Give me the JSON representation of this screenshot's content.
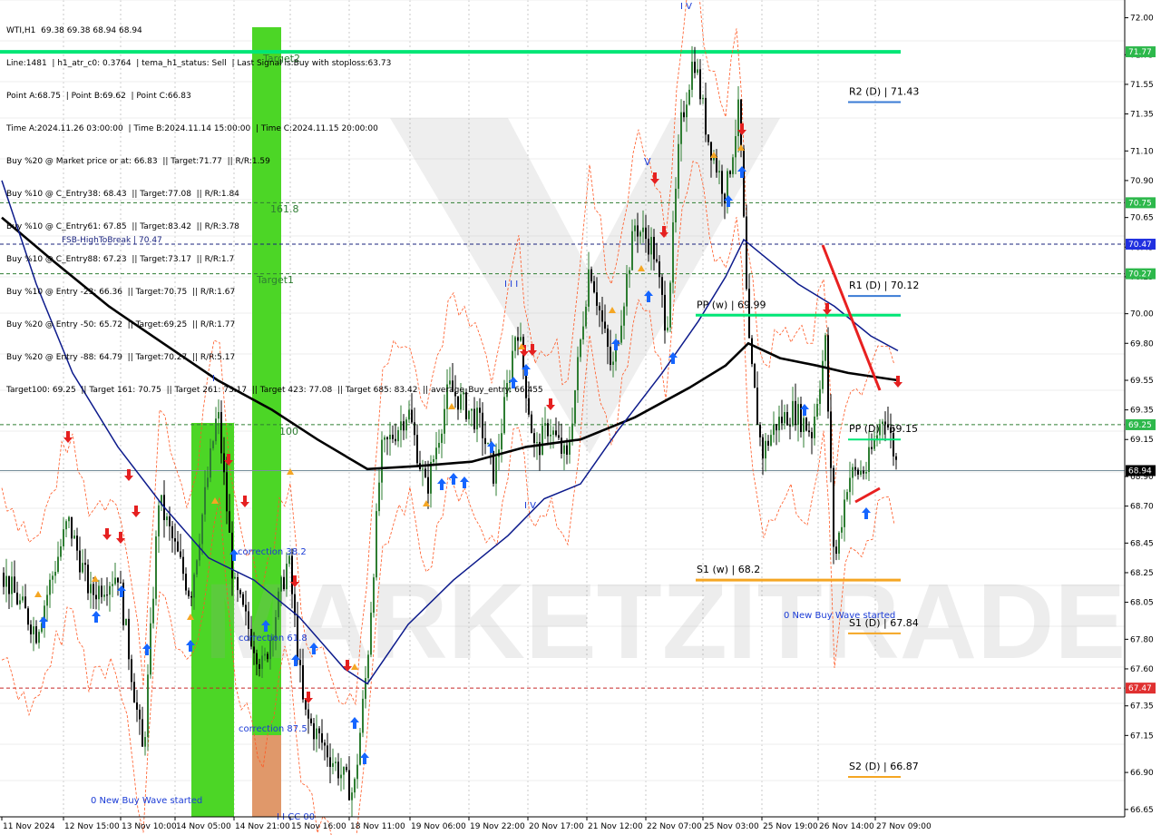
{
  "info_lines": [
    "WTI,H1  69.38 69.38 68.94 68.94",
    "Line:1481  | h1_atr_c0: 0.3764  | tema_h1_status: Sell  | Last Signal is:Buy with stoploss:63.73",
    "Point A:68.75  | Point B:69.62  | Point C:66.83",
    "Time A:2024.11.26 03:00:00  | Time B:2024.11.14 15:00:00  | Time C:2024.11.15 20:00:00",
    "Buy %20 @ Market price or at: 66.83  || Target:71.77  || R/R:1.59",
    "Buy %10 @ C_Entry38: 68.43  || Target:77.08  || R/R:1.84",
    "Buy %10 @ C_Entry61: 67.85  || Target:83.42  || R/R:3.78",
    "Buy %10 @ C_Entry88: 67.23  || Target:73.17  || R/R:1.7",
    "Buy %10 @ Entry -23: 66.36  || Target:70.75  || R/R:1.67",
    "Buy %20 @ Entry -50: 65.72  || Target:69.25  || R/R:1.77",
    "Buy %20 @ Entry -88: 64.79  || Target:70.27  || R/R:5.17",
    "Target100: 69.25  || Target 161: 70.75  || Target 261: 73.17  || Target 423: 77.08  || Target 685: 83.42  || average_Buy_entry: 66.455"
  ],
  "chart_data": {
    "type": "candlestick",
    "symbol": "WTI",
    "timeframe": "H1",
    "ylim": [
      66.6,
      72.12
    ],
    "y_ticks": [
      "72.00",
      "71.75",
      "71.55",
      "71.35",
      "71.10",
      "70.90",
      "70.65",
      "70.45",
      "70.25",
      "70.00",
      "69.80",
      "69.55",
      "69.35",
      "69.15",
      "68.90",
      "68.70",
      "68.45",
      "68.25",
      "68.05",
      "67.80",
      "67.60",
      "67.35",
      "67.15",
      "66.90",
      "66.65"
    ],
    "x_ticks": [
      "11 Nov 2024",
      "12 Nov 15:00",
      "13 Nov 10:00",
      "14 Nov 05:00",
      "14 Nov 21:00",
      "15 Nov 16:00",
      "18 Nov 11:00",
      "19 Nov 06:00",
      "19 Nov 22:00",
      "20 Nov 17:00",
      "21 Nov 12:00",
      "22 Nov 07:00",
      "25 Nov 03:00",
      "25 Nov 19:00",
      "26 Nov 14:00",
      "27 Nov 09:00"
    ],
    "current_price": "68.94",
    "price_tags": [
      {
        "label": "71.77",
        "value": 71.77,
        "color": "#2db84b"
      },
      {
        "label": "70.75",
        "value": 70.75,
        "color": "#2db84b"
      },
      {
        "label": "70.47",
        "value": 70.47,
        "color": "#2030e0"
      },
      {
        "label": "70.27",
        "value": 70.27,
        "color": "#2db84b"
      },
      {
        "label": "69.25",
        "value": 69.25,
        "color": "#2db84b"
      },
      {
        "label": "68.94",
        "value": 68.94,
        "color": "#000000"
      },
      {
        "label": "67.47",
        "value": 67.47,
        "color": "#e03030"
      }
    ],
    "horizontal_levels": [
      {
        "name": "target-2",
        "value": 71.77,
        "color": "#00e676",
        "style": "solid"
      },
      {
        "name": "target-161",
        "value": 70.75,
        "color": "#2e7d32",
        "style": "dashed"
      },
      {
        "name": "fsb-high-to-break",
        "value": 70.47,
        "color": "#1a237e",
        "style": "dashed"
      },
      {
        "name": "target-1",
        "value": 70.27,
        "color": "#2e7d32",
        "style": "dashed"
      },
      {
        "name": "target-100",
        "value": 69.25,
        "color": "#2e7d32",
        "style": "dashed"
      },
      {
        "name": "current-price",
        "value": 68.94,
        "color": "#78909c",
        "style": "solid"
      },
      {
        "name": "stop-level",
        "value": 67.47,
        "color": "#c62828",
        "style": "dashed"
      }
    ],
    "pivot_levels": [
      {
        "label": "R2 (D) | 71.43",
        "value": 71.43,
        "color": "#3a7bd5"
      },
      {
        "label": "R1 (D) | 70.12",
        "value": 70.12,
        "color": "#3a7bd5"
      },
      {
        "label": "PP (D) | 69.15",
        "value": 69.15,
        "color": "#00e676"
      },
      {
        "label": "S1 (D) | 67.84",
        "value": 67.84,
        "color": "#f5a623"
      },
      {
        "label": "S2 (D) | 66.87",
        "value": 66.87,
        "color": "#f5a623"
      },
      {
        "label": "PP (w) | 69.99",
        "value": 69.99,
        "color": "#00e676"
      },
      {
        "label": "S1 (w) | 68.2",
        "value": 68.2,
        "color": "#f5a623"
      }
    ],
    "annotations": {
      "fsb_label": "FSB-HighToBreak | 70.47",
      "target2": "Target2",
      "target1": "Target1",
      "fib_1618": "161.8",
      "fib_100": "100",
      "corr_382": "correction 38.2",
      "corr_618": "correction 61.8",
      "corr_875": "correction 87.5",
      "wave1": "0 New Buy Wave started",
      "wave2": "0 New Buy Wave started",
      "label_ii": "I I",
      "label_iii": "I I I",
      "label_iv_a": "I V",
      "label_iv_b": "I V",
      "label_v": "V",
      "label_i": "I",
      "label_cc": "I I CC 00"
    },
    "series": [
      {
        "name": "moving-average-black",
        "color": "#000000"
      },
      {
        "name": "moving-average-blue",
        "color": "#0d1b8c"
      },
      {
        "name": "atr-band",
        "color": "#ff5722"
      }
    ]
  },
  "watermark": "MARKETZITRADE",
  "colors": {
    "bull": "#2e7d32",
    "bear": "#000000",
    "zone_green": "#4cd626",
    "zone_orange": "#e0986a",
    "buy_arrow": "#1565ff",
    "sell_arrow": "#e52020"
  }
}
